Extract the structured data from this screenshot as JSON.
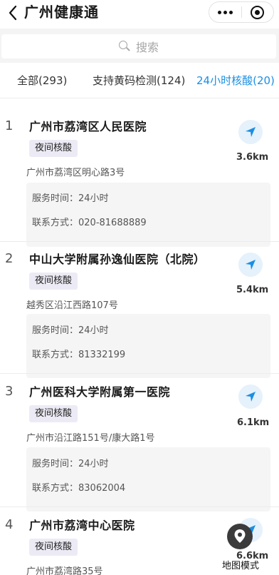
{
  "header": {
    "title": "广州健康通"
  },
  "search": {
    "placeholder": "搜索"
  },
  "tabs": [
    {
      "label": "全部(293)",
      "active": false
    },
    {
      "label": "支持黄码检测(124)",
      "active": false
    },
    {
      "label": "24小时核酸(20)",
      "active": true
    }
  ],
  "accent_color": "#1a8fe3",
  "hospitals": [
    {
      "index": "1",
      "name": "广州市荔湾区人民医院",
      "tag": "夜间核酸",
      "address": "广州市荔湾区明心路3号",
      "hours": "服务时间：24小时",
      "contact": "联系方式：020-81688889",
      "distance": "3.6km"
    },
    {
      "index": "2",
      "name": "中山大学附属孙逸仙医院（北院）",
      "tag": "夜间核酸",
      "address": "越秀区沿江西路107号",
      "hours": "服务时间：24小时",
      "contact": "联系方式：81332199",
      "distance": "5.4km"
    },
    {
      "index": "3",
      "name": "广州医科大学附属第一医院",
      "tag": "夜间核酸",
      "address": "广州市沿江路151号/康大路1号",
      "hours": "服务时间：24小时",
      "contact": "联系方式：83062004",
      "distance": "6.1km"
    },
    {
      "index": "4",
      "name": "广州市荔湾中心医院",
      "tag": "夜间核酸",
      "address": "广州市荔湾路35号",
      "distance": "6.6km"
    }
  ],
  "map_mode": {
    "label": "地图模式",
    "icon": "map-pin-icon"
  }
}
